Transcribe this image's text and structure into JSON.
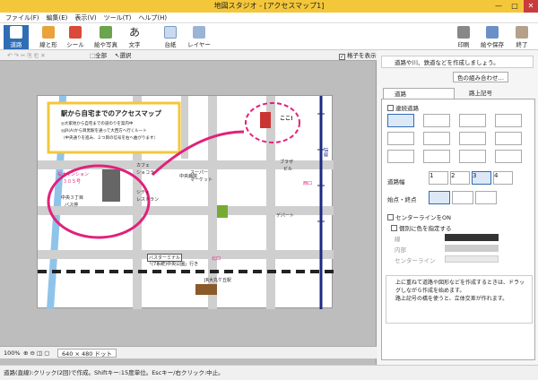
{
  "app": {
    "title": "地図スタジオ - [アクセスマップ1]"
  },
  "menu": [
    "ファイル(F)",
    "編集(E)",
    "表示(V)",
    "ツール(T)",
    "ヘルプ(H)"
  ],
  "toolbar": {
    "items": [
      "道路",
      "線と形",
      "シール",
      "絵や写真",
      "文字",
      "台紙",
      "レイヤー"
    ],
    "right_items": [
      "印刷",
      "絵や保存",
      "終了"
    ]
  },
  "subbar": {
    "all": "全部",
    "select": "選択",
    "show_grid": "格子を表示"
  },
  "map": {
    "title": "駅から自宅までのアクセスマップ",
    "note1": "◎大家地から自宅までの道のりを案内中",
    "note2": "◎JR(A)から目黒駅を通って大西方へ行くルート",
    "note3": "（中央通りを進み、２つ目の信号を右へ曲がります）",
    "labels": {
      "home": "桜木マンション",
      "home2": "３０５号",
      "bus": "中央３丁目",
      "bus2": "バス停",
      "cafe": "カフェ",
      "cafe2": "ショコラ",
      "city": "シティ",
      "city2": "レストラン",
      "hospital": "中央病院",
      "super": "スーパー",
      "super2": "マーケット",
      "plaza": "プラザ",
      "plaza2": "ビル",
      "dept": "デパート",
      "west": "西口",
      "north": "北口",
      "station": "JR大丸ケ丘駅",
      "terminal": "バスターミナル",
      "terminal2": "「(7系統)中央公園」行き",
      "here": "ここ!",
      "tracks": "JR線"
    }
  },
  "bottombar": {
    "size": "640 × 480 ドット",
    "zoom": "100%"
  },
  "panel": {
    "info": "道路や川、鉄道などを作成しましょう。",
    "colors_btn": "色の組み合わせ…",
    "tabs": [
      "道路",
      "路上記号"
    ],
    "linked_road": "連続道路",
    "width_label": "道路幅",
    "width_values": [
      "1",
      "2",
      "3",
      "4"
    ],
    "endpoints": "始点・終点",
    "centerline": "センターラインをON",
    "custom_color": "個別に色を指定する",
    "line_label": "線",
    "inner_label": "内部",
    "center_label": "センターライン",
    "tip1": "上に重ねて道路や図形などを作成するときは、ドラッグしながら作成を始めます。",
    "tip2": "路上記号の橋を使うと、立体交差が作れます。"
  },
  "status": {
    "text": "道路(直線):クリック(2回)で作成。Shiftキー:15度単位。Escキー/右クリック:中止。"
  },
  "colors": {
    "accent": "#2f6db5",
    "title": "#f4c73a",
    "pink": "#e2217a",
    "road": "#c8c8c8"
  }
}
